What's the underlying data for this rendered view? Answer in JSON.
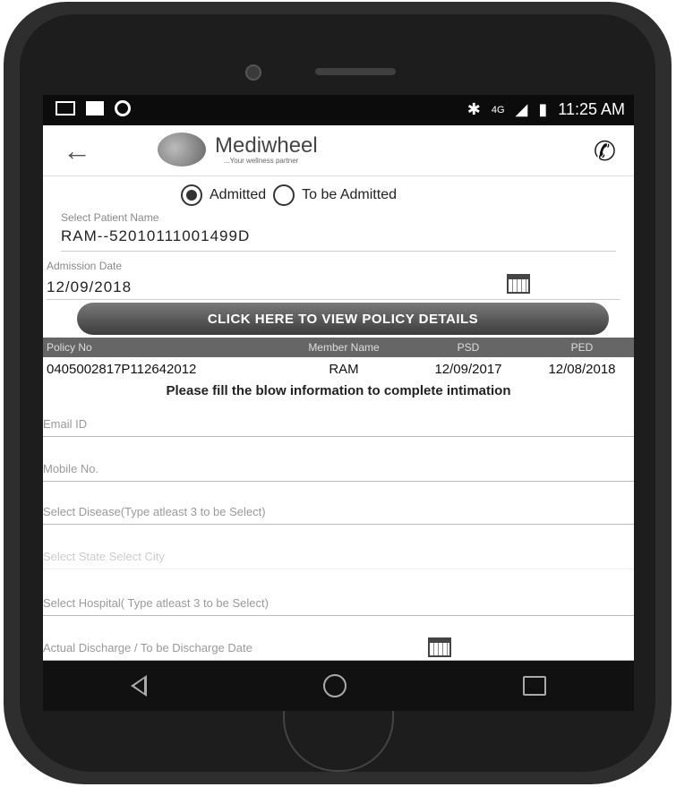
{
  "status_bar": {
    "time": "11:25 AM",
    "network": "4G",
    "icons": [
      "mail-icon",
      "image-icon",
      "circle-icon",
      "bluetooth-icon",
      "signal-icon",
      "battery-icon"
    ]
  },
  "app": {
    "name": "Mediwheel",
    "tagline": "...Your wellness partner"
  },
  "admission": {
    "option_admitted": "Admitted",
    "option_to_be_admitted": "To be Admitted",
    "selected": "Admitted"
  },
  "patient": {
    "label": "Select Patient Name",
    "value": "RAM--5201011100149​9D"
  },
  "admission_date": {
    "label": "Admission Date",
    "value": "12/09/2018"
  },
  "policy_button": "CLICK HERE TO VIEW POLICY DETAILS",
  "policy_table": {
    "headers": [
      "Policy No",
      "Member Name",
      "PSD",
      "PED"
    ],
    "rows": [
      [
        "0405002817P112642012",
        "RAM",
        "12/09/2017",
        "12/08/2018"
      ]
    ]
  },
  "note": "Please fill the blow information to complete intimation",
  "fields": {
    "email": "Email ID",
    "mobile": "Mobile No.",
    "disease": "Select Disease(Type atleast 3 to be Select)",
    "city": "Select State        Select City",
    "hospital": "Select Hospital( Type atleast 3 to be Select)",
    "discharge": "Actual Discharge / To be Discharge Date"
  }
}
